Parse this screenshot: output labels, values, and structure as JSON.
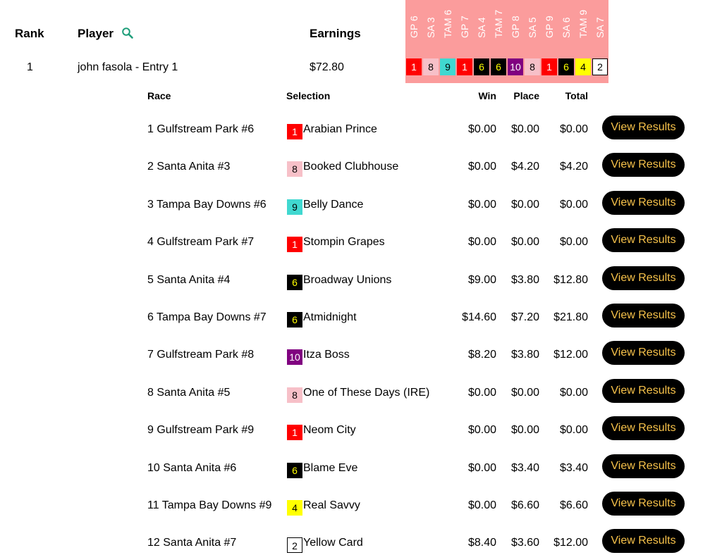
{
  "header": {
    "rank_label": "Rank",
    "player_label": "Player",
    "earnings_label": "Earnings"
  },
  "player": {
    "rank": "1",
    "name": "john fasola - Entry 1",
    "earnings": "$72.80"
  },
  "race_labels": [
    "GP 6",
    "SA 3",
    "TAM 6",
    "GP 7",
    "SA 4",
    "TAM 7",
    "GP 8",
    "SA 5",
    "GP 9",
    "SA 6",
    "TAM 9",
    "SA 7"
  ],
  "chips": [
    {
      "num": "1",
      "bg": "#ff0000",
      "fg": "#ffffff"
    },
    {
      "num": "8",
      "bg": "#f7c0c8",
      "fg": "#000000"
    },
    {
      "num": "9",
      "bg": "#40d8d0",
      "fg": "#000000"
    },
    {
      "num": "1",
      "bg": "#ff0000",
      "fg": "#ffffff"
    },
    {
      "num": "6",
      "bg": "#000000",
      "fg": "#ffff00"
    },
    {
      "num": "6",
      "bg": "#000000",
      "fg": "#ffff00"
    },
    {
      "num": "10",
      "bg": "#800080",
      "fg": "#ffffff"
    },
    {
      "num": "8",
      "bg": "#f7c0c8",
      "fg": "#000000"
    },
    {
      "num": "1",
      "bg": "#ff0000",
      "fg": "#ffffff"
    },
    {
      "num": "6",
      "bg": "#000000",
      "fg": "#ffff00"
    },
    {
      "num": "4",
      "bg": "#ffff00",
      "fg": "#000000"
    },
    {
      "num": "2",
      "bg": "#ffffff",
      "fg": "#000000",
      "border": "#000000"
    }
  ],
  "table": {
    "headers": {
      "race": "Race",
      "selection": "Selection",
      "win": "Win",
      "place": "Place",
      "total": "Total"
    },
    "button_label": "View Results",
    "rows": [
      {
        "race": "1 Gulfstream Park #6",
        "chip": "1",
        "chip_bg": "#ff0000",
        "chip_fg": "#ffffff",
        "horse": "Arabian Prince",
        "win": "$0.00",
        "place": "$0.00",
        "total": "$0.00"
      },
      {
        "race": "2 Santa Anita #3",
        "chip": "8",
        "chip_bg": "#f7c0c8",
        "chip_fg": "#000000",
        "horse": "Booked Clubhouse",
        "win": "$0.00",
        "place": "$4.20",
        "total": "$4.20"
      },
      {
        "race": "3 Tampa Bay Downs #6",
        "chip": "9",
        "chip_bg": "#40d8d0",
        "chip_fg": "#000000",
        "horse": "Belly Dance",
        "win": "$0.00",
        "place": "$0.00",
        "total": "$0.00"
      },
      {
        "race": "4 Gulfstream Park #7",
        "chip": "1",
        "chip_bg": "#ff0000",
        "chip_fg": "#ffffff",
        "horse": "Stompin Grapes",
        "win": "$0.00",
        "place": "$0.00",
        "total": "$0.00"
      },
      {
        "race": "5 Santa Anita #4",
        "chip": "6",
        "chip_bg": "#000000",
        "chip_fg": "#ffff00",
        "horse": "Broadway Unions",
        "win": "$9.00",
        "place": "$3.80",
        "total": "$12.80"
      },
      {
        "race": "6 Tampa Bay Downs #7",
        "chip": "6",
        "chip_bg": "#000000",
        "chip_fg": "#ffff00",
        "horse": "Atmidnight",
        "win": "$14.60",
        "place": "$7.20",
        "total": "$21.80"
      },
      {
        "race": "7 Gulfstream Park #8",
        "chip": "10",
        "chip_bg": "#800080",
        "chip_fg": "#ffffff",
        "horse": "Itza Boss",
        "win": "$8.20",
        "place": "$3.80",
        "total": "$12.00"
      },
      {
        "race": "8 Santa Anita #5",
        "chip": "8",
        "chip_bg": "#f7c0c8",
        "chip_fg": "#000000",
        "horse": "One of These Days (IRE)",
        "win": "$0.00",
        "place": "$0.00",
        "total": "$0.00"
      },
      {
        "race": "9 Gulfstream Park #9",
        "chip": "1",
        "chip_bg": "#ff0000",
        "chip_fg": "#ffffff",
        "horse": "Neom City",
        "win": "$0.00",
        "place": "$0.00",
        "total": "$0.00"
      },
      {
        "race": "10 Santa Anita #6",
        "chip": "6",
        "chip_bg": "#000000",
        "chip_fg": "#ffff00",
        "horse": "Blame Eve",
        "win": "$0.00",
        "place": "$3.40",
        "total": "$3.40"
      },
      {
        "race": "11 Tampa Bay Downs #9",
        "chip": "4",
        "chip_bg": "#ffff00",
        "chip_fg": "#000000",
        "horse": "Real Savvy",
        "win": "$0.00",
        "place": "$6.60",
        "total": "$6.60"
      },
      {
        "race": "12 Santa Anita #7",
        "chip": "2",
        "chip_bg": "#ffffff",
        "chip_fg": "#000000",
        "chip_border": "#000000",
        "horse": "Yellow Card",
        "win": "$8.40",
        "place": "$3.60",
        "total": "$12.00"
      }
    ]
  },
  "colors": {
    "panel": "#fb9c9c",
    "button_bg": "#000000",
    "button_text": "#f7c24a",
    "search_icon": "#1f9e7a"
  },
  "icons": {
    "search": "search-icon"
  }
}
